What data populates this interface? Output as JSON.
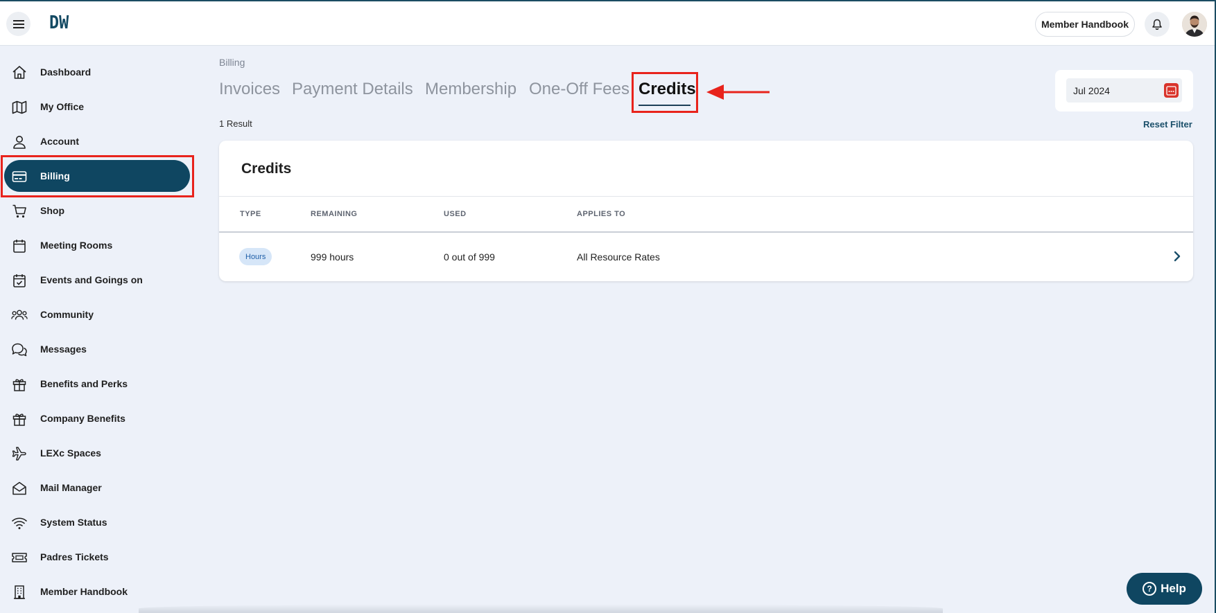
{
  "app": {
    "logo": "DW"
  },
  "topbar": {
    "handbook_label": "Member Handbook"
  },
  "sidebar": {
    "items": [
      {
        "label": "Dashboard",
        "icon": "home-icon",
        "active": false
      },
      {
        "label": "My Office",
        "icon": "map-icon",
        "active": false
      },
      {
        "label": "Account",
        "icon": "user-icon",
        "active": false
      },
      {
        "label": "Billing",
        "icon": "credit-card-icon",
        "active": true
      },
      {
        "label": "Shop",
        "icon": "cart-icon",
        "active": false
      },
      {
        "label": "Meeting Rooms",
        "icon": "calendar-icon",
        "active": false
      },
      {
        "label": "Events and Goings on",
        "icon": "calendar-check-icon",
        "active": false
      },
      {
        "label": "Community",
        "icon": "users-icon",
        "active": false
      },
      {
        "label": "Messages",
        "icon": "chat-icon",
        "active": false
      },
      {
        "label": "Benefits and Perks",
        "icon": "gift-icon",
        "active": false
      },
      {
        "label": "Company Benefits",
        "icon": "gift-icon",
        "active": false
      },
      {
        "label": "LEXc Spaces",
        "icon": "plane-icon",
        "active": false
      },
      {
        "label": "Mail Manager",
        "icon": "mail-open-icon",
        "active": false
      },
      {
        "label": "System Status",
        "icon": "wifi-icon",
        "active": false
      },
      {
        "label": "Padres Tickets",
        "icon": "ticket-icon",
        "active": false
      },
      {
        "label": "Member Handbook",
        "icon": "building-icon",
        "active": false
      }
    ]
  },
  "main": {
    "breadcrumb": "Billing",
    "tabs": [
      {
        "label": "Invoices",
        "active": false
      },
      {
        "label": "Payment Details",
        "active": false
      },
      {
        "label": "Membership",
        "active": false
      },
      {
        "label": "One-Off Fees",
        "active": false
      },
      {
        "label": "Credits",
        "active": true
      }
    ],
    "date_filter": "Jul 2024",
    "result_count": "1 Result",
    "reset_filter": "Reset Filter",
    "card": {
      "title": "Credits",
      "columns": [
        "TYPE",
        "REMAINING",
        "USED",
        "APPLIES TO"
      ],
      "rows": [
        {
          "type": "Hours",
          "remaining": "999 hours",
          "used": "0 out of 999",
          "applies_to": "All Resource Rates"
        }
      ]
    }
  },
  "help": {
    "label": "Help"
  },
  "colors": {
    "primary": "#0f4661",
    "highlight": "#e8231c",
    "background": "#edf1f9"
  }
}
